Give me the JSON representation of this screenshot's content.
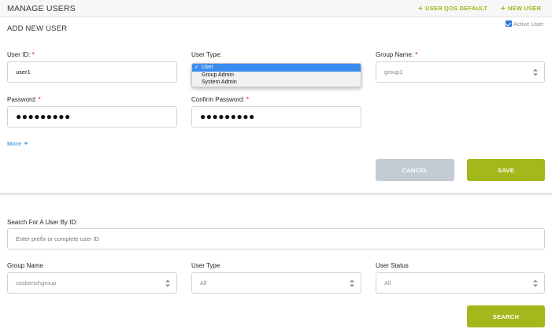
{
  "header": {
    "title": "MANAGE USERS",
    "actions": [
      {
        "icon": "plus-icon",
        "label": "USER QOS DEFAULT"
      },
      {
        "icon": "plus-icon",
        "label": "NEW USER"
      }
    ]
  },
  "add_user": {
    "title": "ADD NEW USER",
    "active_user": {
      "label": "Active User",
      "checked": true
    },
    "user_id": {
      "label": "User ID:",
      "required": "*",
      "value": "user1"
    },
    "user_type": {
      "label": "User Type:",
      "options": [
        {
          "label": "User",
          "selected": true,
          "check": "✓"
        },
        {
          "label": "Group Admin",
          "selected": false
        },
        {
          "label": "System Admin",
          "selected": false
        }
      ]
    },
    "group_name": {
      "label": "Group Name:",
      "required": "*",
      "value": "group1"
    },
    "password": {
      "label": "Password:",
      "required": "*",
      "value": "●●●●●●●●●"
    },
    "confirm_password": {
      "label": "Confirm Password:",
      "required": "*",
      "value": "●●●●●●●●●"
    },
    "more_label": "More",
    "cancel_label": "CANCEL",
    "save_label": "SAVE"
  },
  "search": {
    "by_id_label": "Search For A User By ID:",
    "by_id_placeholder": "Enter prefix or complete user ID",
    "group_name": {
      "label": "Group Name",
      "value": "cosbenchgroup"
    },
    "user_type": {
      "label": "User Type",
      "value": "All"
    },
    "user_status": {
      "label": "User Status",
      "value": "All"
    },
    "search_label": "SEARCH"
  },
  "colors": {
    "accent_green": "#a3b81a",
    "link_green": "#9cb81a",
    "cancel_gray": "#c3cbd3",
    "selection_blue": "#3c8cf0",
    "more_blue": "#5aa6e0",
    "required_red": "#d0021b"
  }
}
